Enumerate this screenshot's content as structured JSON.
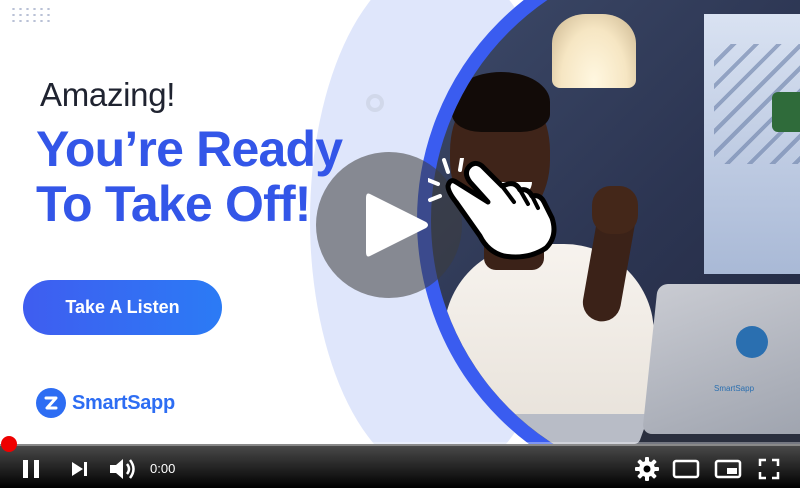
{
  "thumbnail": {
    "eyebrow": "Amazing!",
    "headline_line1": "You’re Ready",
    "headline_line2": "To Take Off!",
    "cta_label": "Take A Listen",
    "brand_name": "SmartSapp",
    "laptop_brand": "SmartSapp"
  },
  "player": {
    "current_time": "0:00",
    "progress_fraction": 0,
    "play_icon": "play-icon",
    "pause_icon": "pause-icon"
  },
  "colors": {
    "headline_blue": "#3356e8",
    "cta_gradient_start": "#3f5df0",
    "cta_gradient_end": "#2b7bf5",
    "brand_blue": "#2d6df3",
    "progress_red": "#ff0000",
    "ring_blue": "#3a5cf0"
  }
}
